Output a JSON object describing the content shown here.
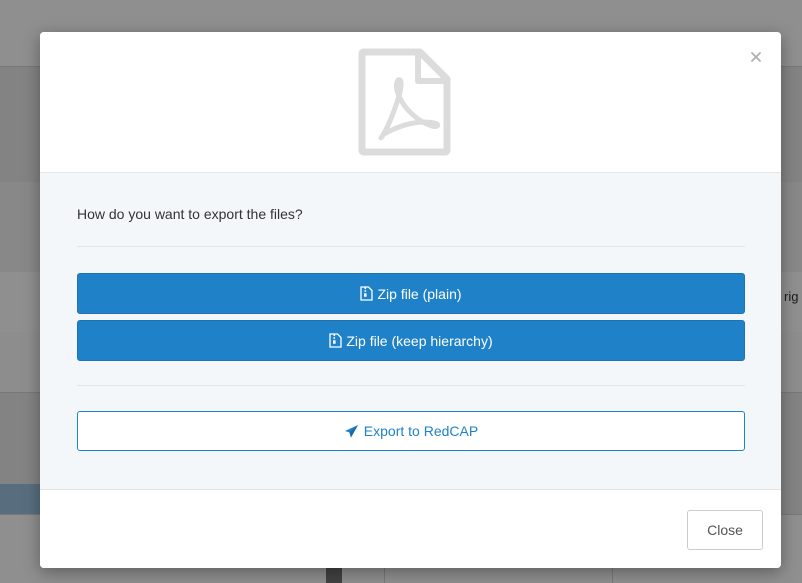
{
  "background": {
    "peek_text": "rig"
  },
  "modal": {
    "header_icon": "file-pdf-icon",
    "close_icon": "close-icon",
    "question": "How do you want to export the files?",
    "buttons": {
      "zip_plain": {
        "label": "Zip file (plain)",
        "icon": "file-archive-icon"
      },
      "zip_hierarchy": {
        "label": "Zip file (keep hierarchy)",
        "icon": "file-archive-icon"
      },
      "redcap": {
        "label": "Export to RedCAP",
        "icon": "paper-plane-icon"
      }
    },
    "footer": {
      "close_label": "Close"
    }
  },
  "colors": {
    "primary": "#1f82c8",
    "body_bg": "#f4f7f9",
    "icon_gray": "#dcdcdc"
  }
}
